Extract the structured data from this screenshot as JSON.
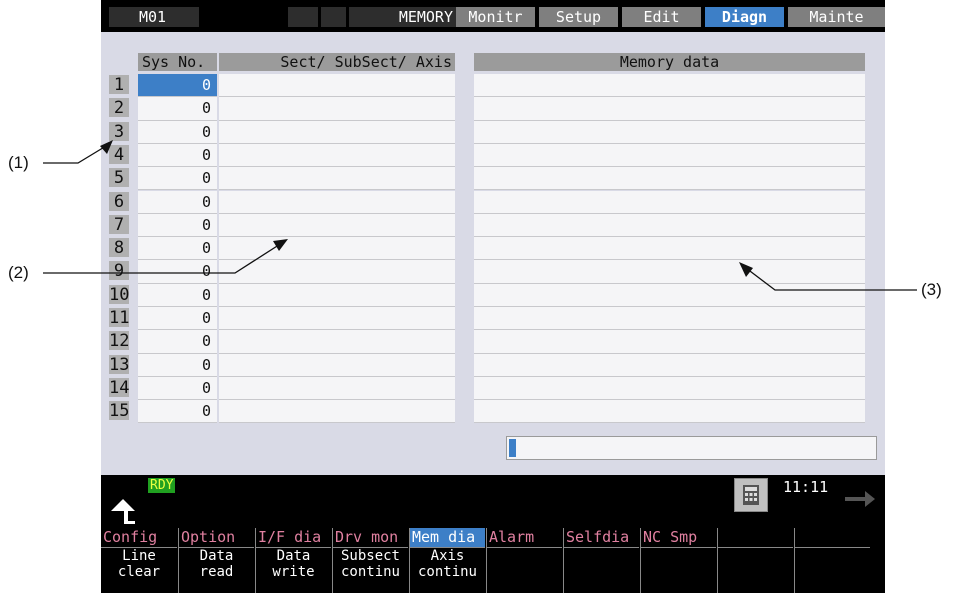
{
  "header": {
    "system": "M01",
    "mode": "MEMORY",
    "tabs": [
      {
        "label": "Monitr",
        "active": false
      },
      {
        "label": "Setup",
        "active": false
      },
      {
        "label": "Edit",
        "active": false
      },
      {
        "label": "Diagn",
        "active": true
      },
      {
        "label": "Mainte",
        "active": false
      }
    ]
  },
  "table": {
    "col_sysno": "Sys No.",
    "col_sect": "Sect/ SubSect/ Axis",
    "col_memory": "Memory data",
    "rows": [
      {
        "n": "1",
        "v": "0"
      },
      {
        "n": "2",
        "v": "0"
      },
      {
        "n": "3",
        "v": "0"
      },
      {
        "n": "4",
        "v": "0"
      },
      {
        "n": "5",
        "v": "0"
      },
      {
        "n": "6",
        "v": "0"
      },
      {
        "n": "7",
        "v": "0"
      },
      {
        "n": "8",
        "v": "0"
      },
      {
        "n": "9",
        "v": "0"
      },
      {
        "n": "10",
        "v": "0"
      },
      {
        "n": "11",
        "v": "0"
      },
      {
        "n": "12",
        "v": "0"
      },
      {
        "n": "13",
        "v": "0"
      },
      {
        "n": "14",
        "v": "0"
      },
      {
        "n": "15",
        "v": "0"
      }
    ]
  },
  "progress": 0.02,
  "status": {
    "rdy": "RDY",
    "clock": "11:11"
  },
  "menu": [
    {
      "top": "Config",
      "sub1": "Line",
      "sub2": "clear",
      "active": false
    },
    {
      "top": "Option",
      "sub1": "Data",
      "sub2": "read",
      "active": false
    },
    {
      "top": "I/F dia",
      "sub1": "Data",
      "sub2": "write",
      "active": false
    },
    {
      "top": "Drv mon",
      "sub1": "Subsect",
      "sub2": "continu",
      "active": false
    },
    {
      "top": "Mem dia",
      "sub1": "Axis",
      "sub2": "continu",
      "active": true
    },
    {
      "top": "Alarm",
      "sub1": "",
      "sub2": "",
      "active": false
    },
    {
      "top": "Selfdia",
      "sub1": "",
      "sub2": "",
      "active": false
    },
    {
      "top": "NC Smp",
      "sub1": "",
      "sub2": "",
      "active": false
    },
    {
      "top": "",
      "sub1": "",
      "sub2": "",
      "active": false
    },
    {
      "top": "",
      "sub1": "",
      "sub2": "",
      "active": false
    }
  ],
  "callouts": {
    "c1": "(1)",
    "c2": "(2)",
    "c3": "(3)"
  },
  "colors": {
    "accent": "#3d7fc7",
    "menu_text": "#e080a0",
    "rdy_bg": "#20a020"
  }
}
